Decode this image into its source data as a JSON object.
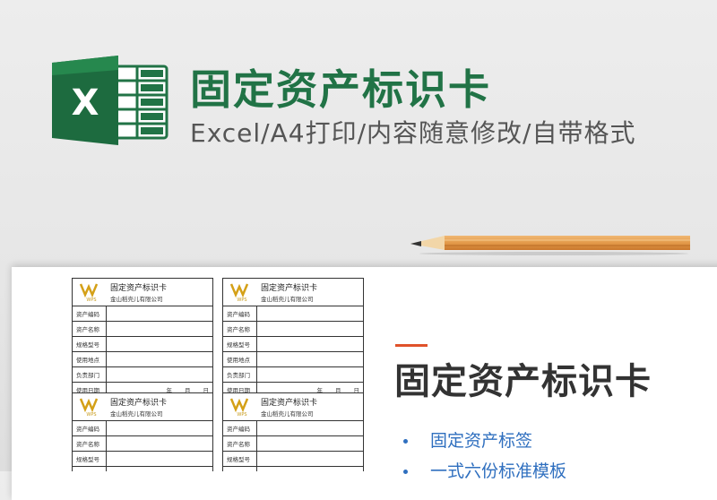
{
  "header": {
    "title": "固定资产标识卡",
    "subtitle": "Excel/A4打印/内容随意修改/自带格式",
    "logo_icon": "excel-logo-icon",
    "colors": {
      "excel_green": "#217346",
      "accent": "#e0522a",
      "bullet_blue": "#2f6fbf"
    }
  },
  "card": {
    "title": "固定资产标识卡",
    "company": "金山稻壳儿有限公司",
    "logo_icon": "wps-logo-icon",
    "fields": [
      "资产编码",
      "资产名称",
      "规格型号",
      "使用地点",
      "负责部门",
      "使用日期"
    ],
    "date_units": [
      "年",
      "月",
      "日"
    ]
  },
  "main": {
    "title": "固定资产标识卡",
    "bullets": [
      "固定资产标签",
      "一式六份标准模板"
    ]
  }
}
